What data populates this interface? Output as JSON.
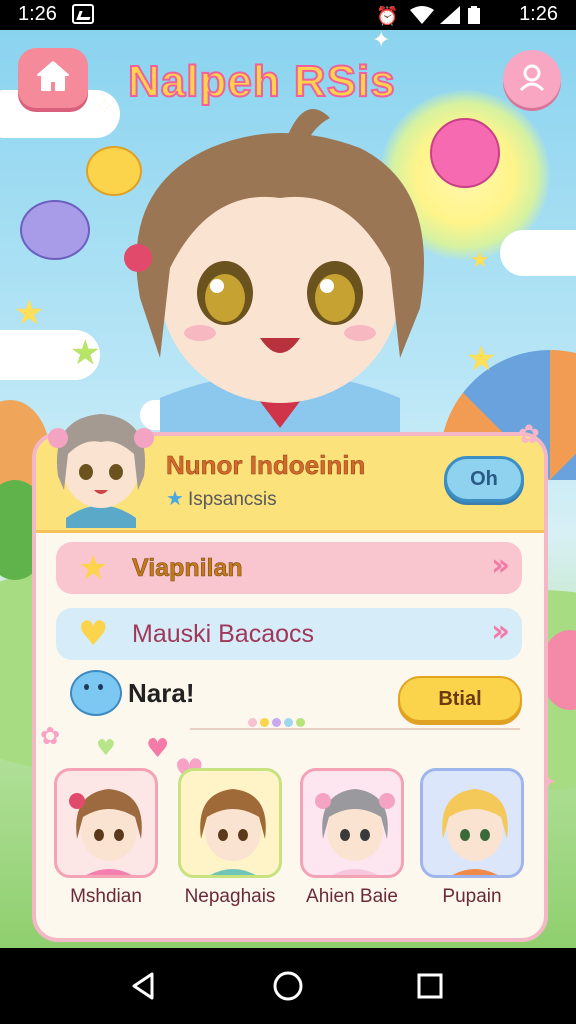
{
  "status_bar": {
    "time_left": "1:26",
    "time_right": "1:26"
  },
  "header": {
    "app_title": "Nalpeh RSis",
    "home_icon": "home-icon",
    "profile_icon": "person-icon"
  },
  "profile": {
    "name": "Nunor Indoeinin",
    "subtitle": "Ispsancsis",
    "action_label": "Oh"
  },
  "menu": {
    "items": [
      {
        "label": "Viapnilan",
        "icon": "star-icon"
      },
      {
        "label": "Mauski Bacaocs",
        "icon": "heart-icon"
      }
    ]
  },
  "secondary": {
    "label": "Nara!",
    "button_label": "Btial"
  },
  "characters": [
    {
      "name": "Mshdian",
      "bg": "#fde6e6",
      "border": "#f4a3b6",
      "hair": "#9c6a3e",
      "shirt": "#f57fb0"
    },
    {
      "name": "Nepaghais",
      "bg": "#fff3c8",
      "border": "#c7e27f",
      "hair": "#a06a38",
      "shirt": "#6fc6b8"
    },
    {
      "name": "Ahien Baie",
      "bg": "#fde6f0",
      "border": "#f4a3b6",
      "hair": "#9a9a9e",
      "shirt": "#f5c6dc"
    },
    {
      "name": "Pupain",
      "bg": "#dbe6fb",
      "border": "#9fb6ec",
      "hair": "#f5c85a",
      "shirt": "#f08a4a"
    }
  ],
  "colors": {
    "accent_pink": "#f58a9a",
    "accent_yellow": "#fcd44c",
    "accent_blue": "#8fd2f0"
  }
}
